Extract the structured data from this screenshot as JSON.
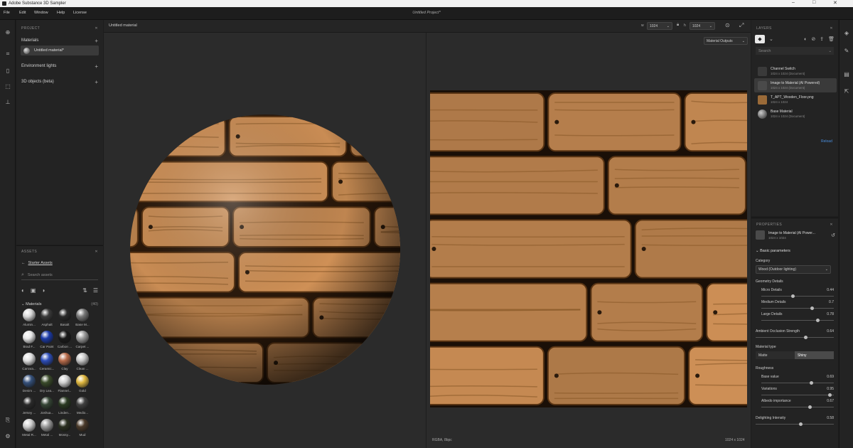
{
  "app": {
    "title": "Adobe Substance 3D Sampler",
    "project_title": "Untitled Project*"
  },
  "window_controls": [
    "–",
    "□",
    "✕"
  ],
  "menu": [
    "File",
    "Edit",
    "Window",
    "Help",
    "License"
  ],
  "project": {
    "header": "PROJECT",
    "materials_label": "Materials",
    "material_item": "Untitled material*",
    "env_label": "Environment lights",
    "objects_label": "3D objects (beta)"
  },
  "assets": {
    "header": "ASSETS",
    "back_label": "Starter Assets",
    "search_placeholder": "Search assets",
    "section_label": "Materials",
    "count": "(40)",
    "items": [
      {
        "name": "Alumin...",
        "color": "#d8d8d8"
      },
      {
        "name": "Asphalt",
        "color": "#3a3a3a"
      },
      {
        "name": "Basalt",
        "color": "#2a2a2a"
      },
      {
        "name": "Base M...",
        "color": "#777777"
      },
      {
        "name": "Brad F...",
        "color": "#e8e8e8"
      },
      {
        "name": "Car Paint",
        "color": "#1b3aa8"
      },
      {
        "name": "Carbon ...",
        "color": "#1a1a1a"
      },
      {
        "name": "Carpet ...",
        "color": "#9a9a9a"
      },
      {
        "name": "Carrara...",
        "color": "#e0e0e0"
      },
      {
        "name": "Ceramic...",
        "color": "#2d4db8"
      },
      {
        "name": "Clay",
        "color": "#b86b4a"
      },
      {
        "name": "Clean ...",
        "color": "#c8c8c8"
      },
      {
        "name": "Denim ...",
        "color": "#35507a"
      },
      {
        "name": "Dry Lea...",
        "color": "#3a4a2a"
      },
      {
        "name": "Flannel...",
        "color": "#d0d0d0"
      },
      {
        "name": "Gold",
        "color": "#e0b840"
      },
      {
        "name": "Jersey ...",
        "color": "#2a2a2a"
      },
      {
        "name": "Joshua...",
        "color": "#354535"
      },
      {
        "name": "Linden...",
        "color": "#2a3a22"
      },
      {
        "name": "Medio...",
        "color": "#404040"
      },
      {
        "name": "Metal R...",
        "color": "#cfcfcf"
      },
      {
        "name": "Metal ...",
        "color": "#9a9a9a"
      },
      {
        "name": "Mossy...",
        "color": "#2a3020"
      },
      {
        "name": "Mud",
        "color": "#4a3a2a"
      }
    ]
  },
  "viewport": {
    "material_name": "Untitled material",
    "width_label": "w",
    "width_value": "1024",
    "height_label": "h",
    "height_value": "1024",
    "outputs_label": "Material Outputs",
    "format_label": "RGBA, 8bpc",
    "resolution_label": "1024 x 1024"
  },
  "layers": {
    "header": "LAYERS",
    "search_placeholder": "Search",
    "items": [
      {
        "name": "Channel Switch",
        "sub": "1024 x 1024 (Document)"
      },
      {
        "name": "Image to Material (AI Powered)",
        "sub": "1024 x 1024 (Document)"
      },
      {
        "name": "T_APT_Wooden_Floor.png",
        "sub": "1024 x 1024"
      },
      {
        "name": "Base Material",
        "sub": "1024 x 1024 (Document)"
      }
    ],
    "reload_label": "Reload"
  },
  "properties": {
    "header": "PROPERTIES",
    "layer_name": "Image to Material (AI Power...",
    "layer_size": "1024 x 1024",
    "section": "Basic parameters",
    "category_label": "Category",
    "category_value": "Wood (Outdoor lighting)",
    "geometry_label": "Geometry Details",
    "micro": {
      "label": "Micro Details",
      "value": "0.44",
      "frac": 0.44
    },
    "medium": {
      "label": "Medium Details",
      "value": "0.7",
      "frac": 0.7
    },
    "large": {
      "label": "Large Details",
      "value": "0.78",
      "frac": 0.78
    },
    "ao": {
      "label": "Ambient Occlusion Strength",
      "value": "0.64",
      "frac": 0.64
    },
    "material_type_label": "Material type",
    "matte_label": "Matte",
    "shiny_label": "Shiny",
    "roughness_label": "Roughness",
    "base": {
      "label": "Base value",
      "value": "0.69",
      "frac": 0.69
    },
    "variations": {
      "label": "Variations",
      "value": "0.95",
      "frac": 0.95
    },
    "albedo": {
      "label": "Albedo importance",
      "value": "0.67",
      "frac": 0.67
    },
    "delighting": {
      "label": "Delighting Intensity",
      "value": "0.58",
      "frac": 0.58
    }
  }
}
